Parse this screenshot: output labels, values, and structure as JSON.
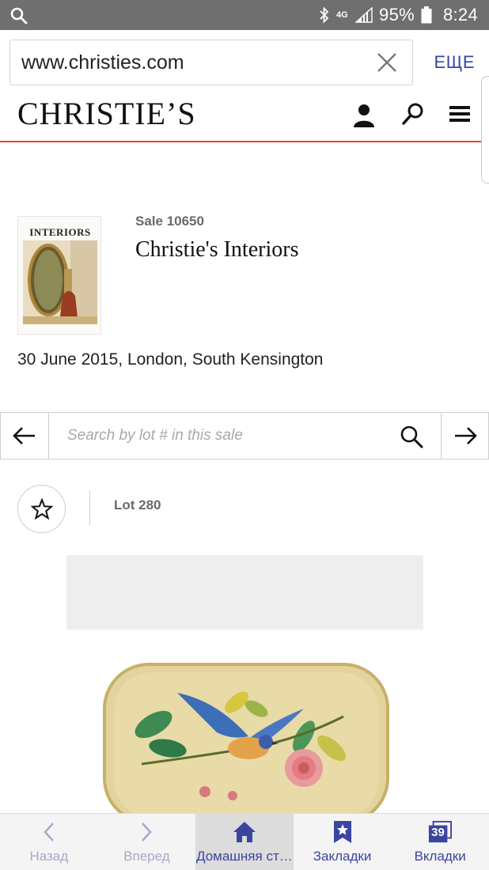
{
  "status_bar": {
    "battery": "95%",
    "time": "8:24",
    "network": "4G",
    "icons": [
      "search-icon",
      "bluetooth-icon",
      "signal-icon",
      "battery-icon"
    ]
  },
  "browser": {
    "url": "www.christies.com",
    "more_label": "ЕЩЕ",
    "accent_color": "#3547a8"
  },
  "site": {
    "logo": "CHRISTIE’S",
    "header_icons": [
      "account-icon",
      "search-icon",
      "menu-icon"
    ],
    "accent_line_color": "#e0452c"
  },
  "sale": {
    "cover_title": "INTERIORS",
    "number_label": "Sale 10650",
    "title": "Christie's Interiors",
    "date_location": "30 June 2015, London, South Kensington"
  },
  "lot_search": {
    "placeholder": "Search by lot # in this sale"
  },
  "lot": {
    "label": "Lot 280"
  },
  "bottom_nav": {
    "items": [
      {
        "label": "Назад",
        "icon": "chevron-left-icon",
        "state": "disabled"
      },
      {
        "label": "Вперед",
        "icon": "chevron-right-icon",
        "state": "disabled"
      },
      {
        "label": "Домашняя страница",
        "icon": "home-icon",
        "state": "active"
      },
      {
        "label": "Закладки",
        "icon": "bookmark-icon",
        "state": "enabled"
      },
      {
        "label": "Вкладки",
        "icon": "tabs-icon",
        "state": "enabled",
        "count": "39"
      }
    ]
  }
}
